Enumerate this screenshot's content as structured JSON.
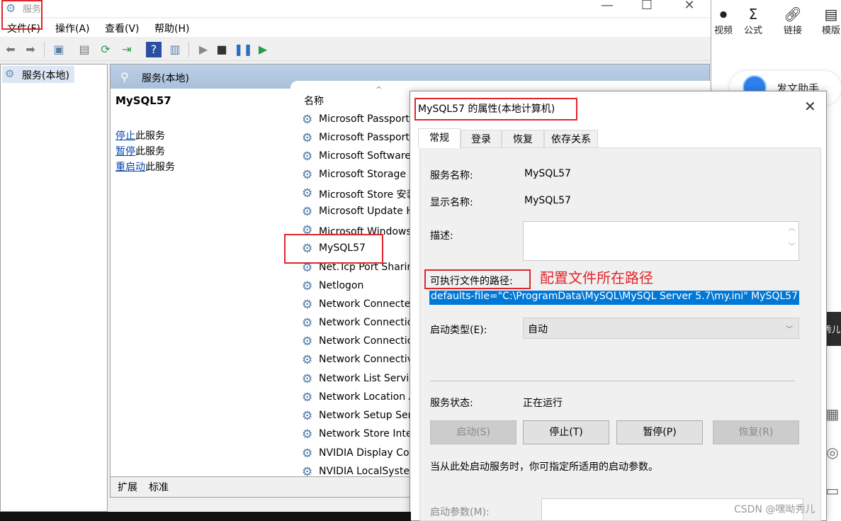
{
  "window": {
    "title": "服务",
    "controls": [
      "—",
      "☐",
      "✕"
    ]
  },
  "menubar": [
    "文件(F)",
    "操作(A)",
    "查看(V)",
    "帮助(H)"
  ],
  "tree": {
    "root": "服务(本地)"
  },
  "panel": {
    "header": "服务(本地)",
    "selected_service": "MySQL57",
    "actions": [
      {
        "link": "停止",
        "suffix": "此服务"
      },
      {
        "link": "暂停",
        "suffix": "此服务"
      },
      {
        "link": "重启动",
        "suffix": "此服务"
      }
    ],
    "column_name": "名称",
    "services": [
      "Microsoft Passport",
      "Microsoft Passport Container",
      "Microsoft Software Shadow Copy Provider",
      "Microsoft Storage Spaces SMP",
      "Microsoft Store 安装服务",
      "Microsoft Update Health Service",
      "Microsoft Windows SMS 路由器服务",
      "MySQL57",
      "Net.Tcp Port Sharing Service",
      "Netlogon",
      "Network Connected Devices Auto-Setup",
      "Network Connection Broker",
      "Network Connections",
      "Network Connectivity Assistant",
      "Network List Service",
      "Network Location Awareness",
      "Network Setup Service",
      "Network Store Interface Service",
      "NVIDIA Display Container LS",
      "NVIDIA LocalSystem Container"
    ],
    "tabs": [
      "扩展",
      "标准"
    ]
  },
  "dialog": {
    "title": "MySQL57 的属性(本地计算机)",
    "tabs": [
      "常规",
      "登录",
      "恢复",
      "依存关系"
    ],
    "service_name_label": "服务名称:",
    "service_name": "MySQL57",
    "display_name_label": "显示名称:",
    "display_name": "MySQL57",
    "description_label": "描述:",
    "exe_path_label": "可执行文件的路径:",
    "exe_path": "defaults-file=\"C:\\ProgramData\\MySQL\\MySQL Server 5.7\\my.ini\" MySQL57",
    "annotation": "配置文件所在路径",
    "startup_type_label": "启动类型(E):",
    "startup_type": "自动",
    "status_label": "服务状态:",
    "status": "正在运行",
    "buttons": [
      "启动(S)",
      "停止(T)",
      "暂停(P)",
      "恢复(R)"
    ],
    "hint": "当从此处启动服务时，你可指定所适用的启动参数。",
    "param_label": "启动参数(M):"
  },
  "editor": {
    "tools": [
      "视频",
      "公式",
      "链接",
      "模版"
    ],
    "assistant": "发文助手",
    "side_text": "秀儿"
  },
  "watermark": "CSDN @嘿呦秀儿",
  "colors": {
    "highlight": "#0078d7",
    "annotation_red": "#e0262b",
    "header_blue": "#b3c8e0"
  }
}
